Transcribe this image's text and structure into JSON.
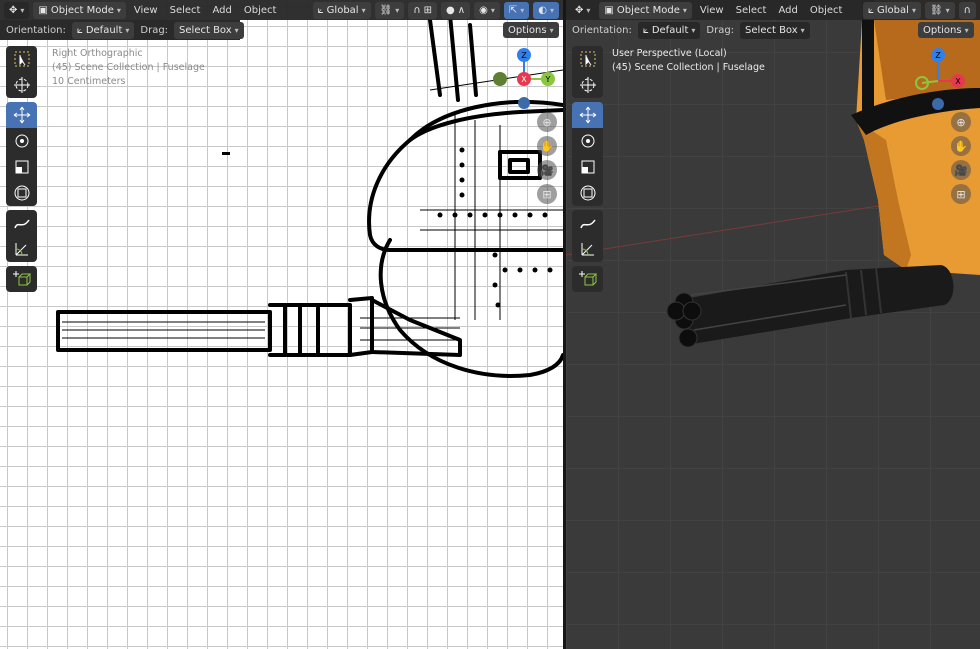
{
  "left": {
    "header": {
      "mode": "Object Mode",
      "menus": [
        "View",
        "Select",
        "Add",
        "Object"
      ],
      "transform_orientation": "Global"
    },
    "subheader": {
      "orientation_label": "Orientation:",
      "orientation_value": "Default",
      "drag_label": "Drag:",
      "drag_value": "Select Box",
      "options": "Options"
    },
    "overlay": {
      "view_name": "Right Orthographic",
      "collection": "(45) Scene Collection | Fuselage",
      "scale": "10 Centimeters"
    },
    "gizmo": {
      "z": "Z",
      "x": "X",
      "y": "Y"
    }
  },
  "right": {
    "header": {
      "mode": "Object Mode",
      "menus": [
        "View",
        "Select",
        "Add",
        "Object"
      ],
      "transform_orientation": "Global"
    },
    "subheader": {
      "orientation_label": "Orientation:",
      "orientation_value": "Default",
      "drag_label": "Drag:",
      "drag_value": "Select Box",
      "options": "Options"
    },
    "overlay": {
      "view_name": "User Perspective (Local)",
      "collection": "(45) Scene Collection | Fuselage"
    },
    "gizmo": {
      "z": "Z",
      "x": "X"
    }
  },
  "colors": {
    "active_tool": "#4772b3",
    "axis_x": "#e8384f",
    "axis_y": "#8cc63f",
    "axis_z": "#2f80ed",
    "mesh_orange": "#e89a33"
  }
}
